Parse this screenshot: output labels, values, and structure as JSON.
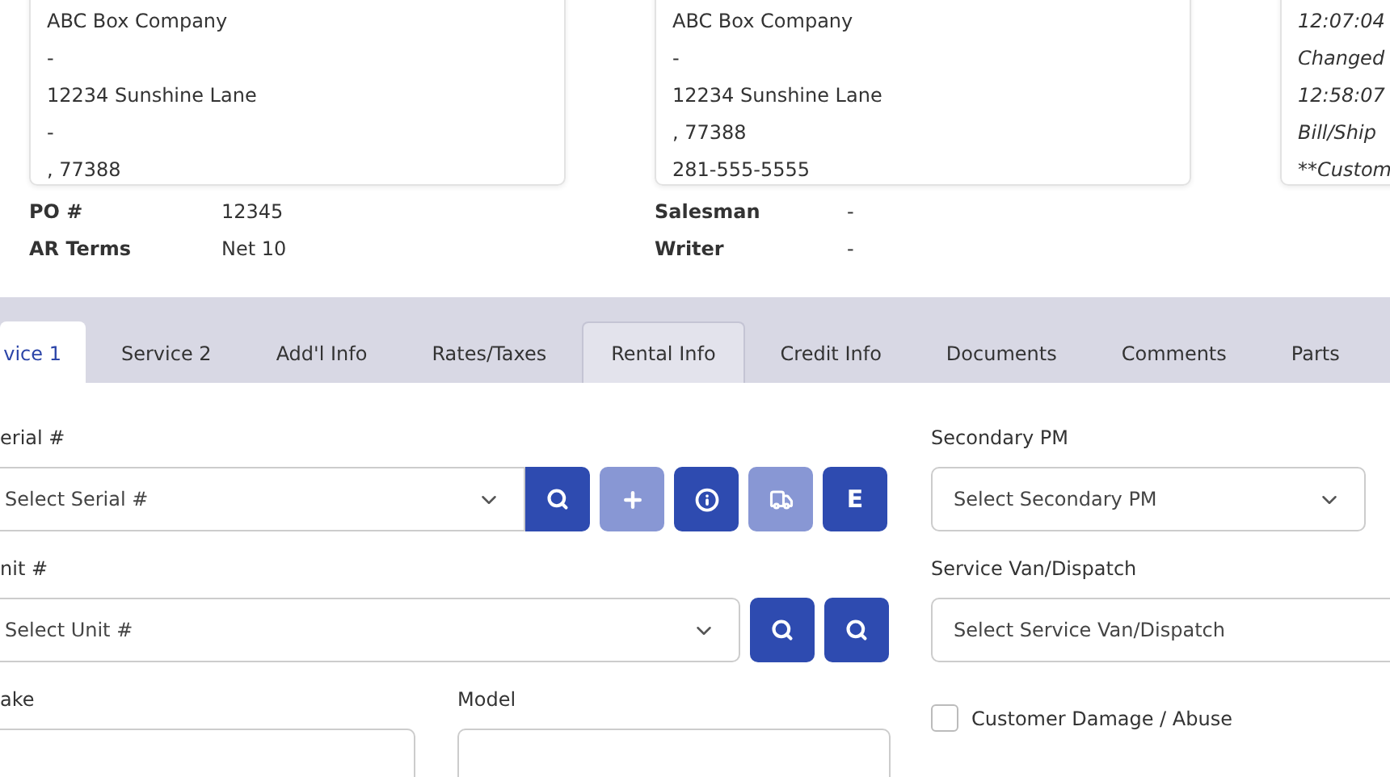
{
  "address_cards": [
    {
      "lines": [
        "ABC Box Company",
        "-",
        "12234 Sunshine Lane",
        "-",
        ", 77388"
      ],
      "italic": false
    },
    {
      "lines": [
        "ABC Box Company",
        "-",
        "12234 Sunshine Lane",
        ", 77388",
        "281-555-5555"
      ],
      "italic": false
    },
    {
      "lines": [
        "12:07:04",
        "Changed",
        "12:58:07",
        "Bill/Ship",
        "**Custom"
      ],
      "italic": true
    }
  ],
  "info_left": [
    {
      "label": "PO #",
      "value": "12345"
    },
    {
      "label": "AR Terms",
      "value": "Net 10"
    }
  ],
  "info_right": [
    {
      "label": "Salesman",
      "value": "-"
    },
    {
      "label": "Writer",
      "value": "-"
    }
  ],
  "tabs": [
    {
      "label": "vice 1",
      "selected": true,
      "hovered": false
    },
    {
      "label": "Service 2",
      "selected": false,
      "hovered": false
    },
    {
      "label": "Add'l Info",
      "selected": false,
      "hovered": false
    },
    {
      "label": "Rates/Taxes",
      "selected": false,
      "hovered": false
    },
    {
      "label": "Rental Info",
      "selected": false,
      "hovered": true
    },
    {
      "label": "Credit Info",
      "selected": false,
      "hovered": false
    },
    {
      "label": "Documents",
      "selected": false,
      "hovered": false
    },
    {
      "label": "Comments",
      "selected": false,
      "hovered": false
    },
    {
      "label": "Parts",
      "selected": false,
      "hovered": false
    }
  ],
  "serial": {
    "label": "erial #",
    "placeholder": "Select Serial #",
    "buttons": [
      {
        "kind": "search",
        "disabled": false,
        "attached": true
      },
      {
        "kind": "add",
        "disabled": true
      },
      {
        "kind": "info",
        "disabled": false
      },
      {
        "kind": "truck",
        "disabled": true
      },
      {
        "kind": "text",
        "text": "E",
        "disabled": false
      }
    ]
  },
  "unit": {
    "label": "nit #",
    "placeholder": "Select Unit #",
    "buttons": [
      {
        "kind": "search",
        "disabled": false
      },
      {
        "kind": "search",
        "disabled": false
      }
    ]
  },
  "make": {
    "label": "ake"
  },
  "model": {
    "label": "Model"
  },
  "secondary_pm": {
    "label": "Secondary PM",
    "placeholder": "Select Secondary PM"
  },
  "service_van": {
    "label": "Service Van/Dispatch",
    "placeholder": "Select Service Van/Dispatch"
  },
  "customer_damage": {
    "label": "Customer Damage / Abuse",
    "checked": false
  }
}
